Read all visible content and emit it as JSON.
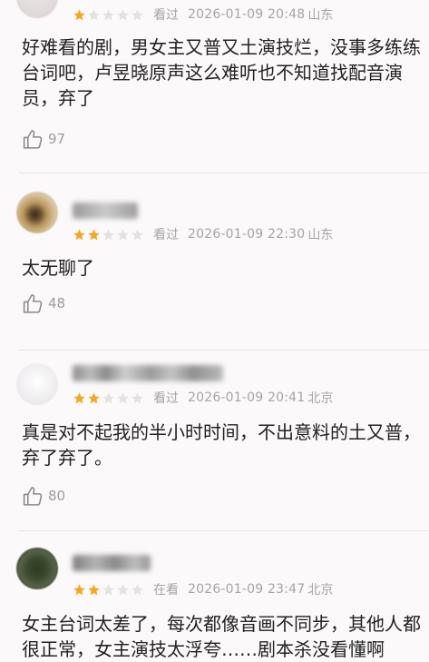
{
  "reviews": [
    {
      "rating": 1,
      "status": "看过",
      "time": "2026-01-09 20:48",
      "location": "山东",
      "content_lines": [
        "好难看的剧，男女主又普又土演技烂，没事多练练",
        "台词吧，卢昱晓原声这么难听也不知道找配音演",
        "员，弃了"
      ],
      "likes": "97"
    },
    {
      "rating": 2,
      "status": "看过",
      "time": "2026-01-09 22:30",
      "location": "山东",
      "content_lines": [
        "太无聊了"
      ],
      "likes": "48"
    },
    {
      "rating": 2,
      "status": "看过",
      "time": "2026-01-09 20:41",
      "location": "北京",
      "content_lines": [
        "真是对不起我的半小时时间，不出意料的土又普，",
        "弃了弃了。"
      ],
      "likes": "80"
    },
    {
      "rating": 2,
      "status": "在看",
      "time": "2026-01-09 23:47",
      "location": "北京",
      "content_lines": [
        "女主台词太差了，每次都像音画不同步，其他人都",
        "很正常，女主演技太浮夸……剧本杀没看懂啊"
      ],
      "likes": ""
    }
  ],
  "colors": {
    "star_filled": "#f5a623",
    "star_empty": "#e2e2e2",
    "meta_text": "#a5a5a5",
    "like_icon": "#8a8a8a"
  },
  "icons": {
    "star": "star-icon",
    "like": "thumbs-up-icon"
  }
}
